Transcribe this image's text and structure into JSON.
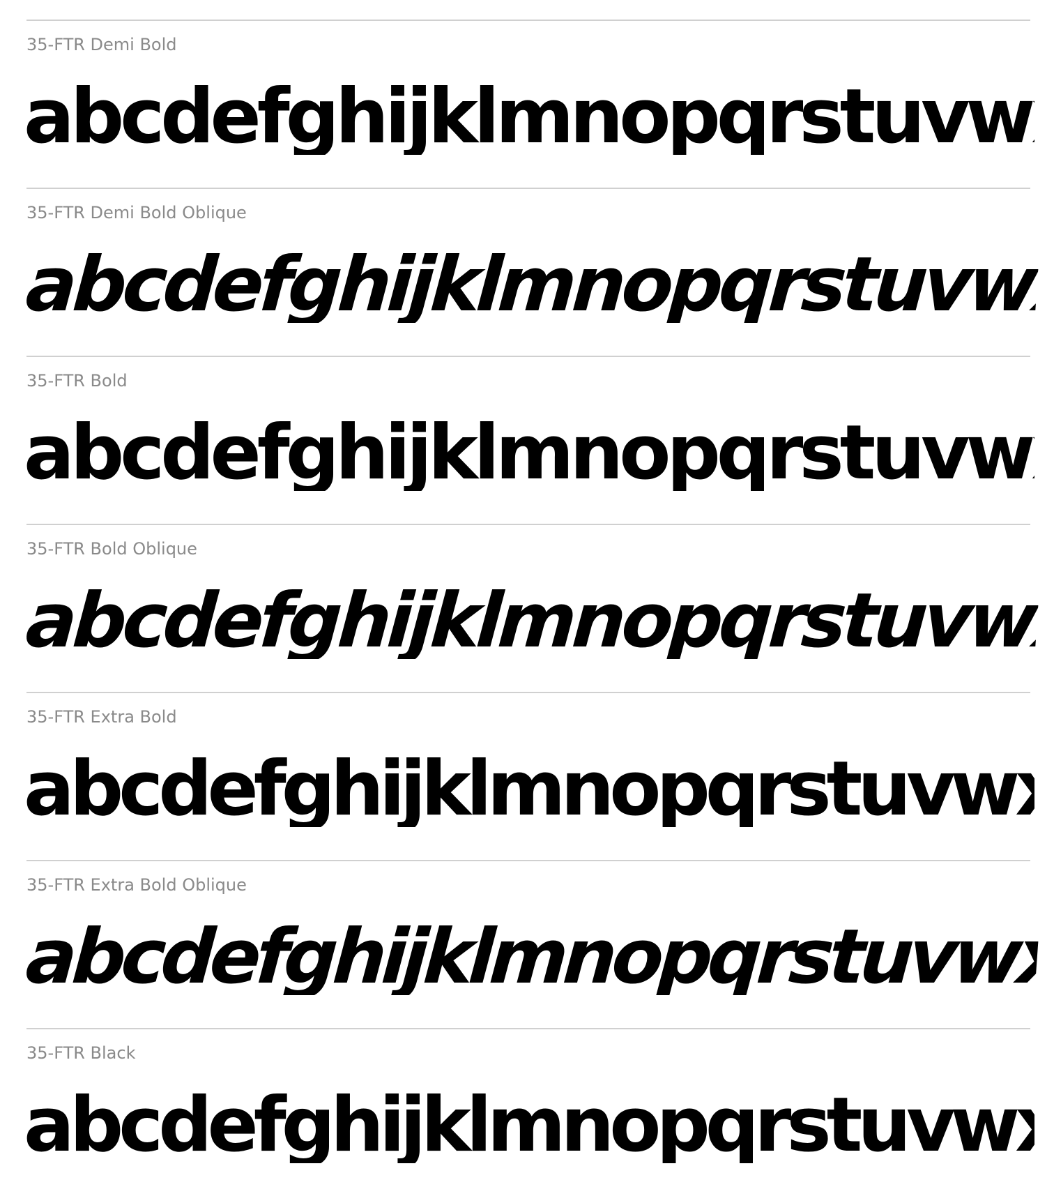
{
  "specimens": [
    {
      "label": "35-FTR Demi Bold",
      "sample": "abcdefghijklmnopqrstuvwxyz"
    },
    {
      "label": "35-FTR Demi Bold Oblique",
      "sample": "abcdefghijklmnopqrstuvwxyz"
    },
    {
      "label": "35-FTR Bold",
      "sample": "abcdefghijklmnopqrstuvwxyz"
    },
    {
      "label": "35-FTR Bold Oblique",
      "sample": "abcdefghijklmnopqrstuvwxyz"
    },
    {
      "label": "35-FTR Extra Bold",
      "sample": "abcdefghijklmnopqrstuvwxyz"
    },
    {
      "label": "35-FTR Extra Bold Oblique",
      "sample": "abcdefghijklmnopqrstuvwxyz"
    },
    {
      "label": "35-FTR Black",
      "sample": "abcdefghijklmnopqrstuvwxyz"
    }
  ]
}
